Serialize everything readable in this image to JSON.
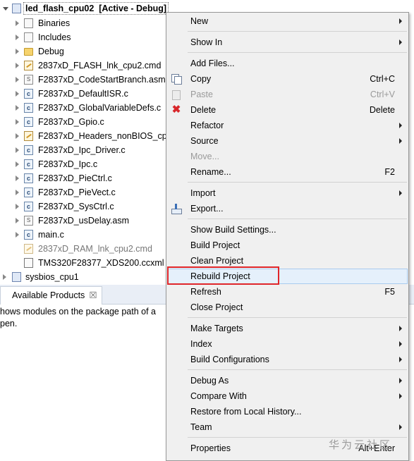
{
  "project": {
    "name": "led_flash_cpu02",
    "state": "[Active - Debug]"
  },
  "tree_items": [
    {
      "label": "Binaries",
      "icon": "binaries-icon",
      "expandable": true
    },
    {
      "label": "Includes",
      "icon": "includes-icon",
      "expandable": true
    },
    {
      "label": "Debug",
      "icon": "folder-icon",
      "expandable": true
    },
    {
      "label": "2837xD_FLASH_lnk_cpu2.cmd",
      "icon": "cmd-file-icon",
      "expandable": true
    },
    {
      "label": "F2837xD_CodeStartBranch.asm",
      "icon": "asm-file-icon",
      "expandable": true
    },
    {
      "label": "F2837xD_DefaultISR.c",
      "icon": "c-file-icon",
      "expandable": true
    },
    {
      "label": "F2837xD_GlobalVariableDefs.c",
      "icon": "c-file-icon",
      "expandable": true
    },
    {
      "label": "F2837xD_Gpio.c",
      "icon": "c-file-icon",
      "expandable": true
    },
    {
      "label": "F2837xD_Headers_nonBIOS_cp",
      "icon": "cmd-file-icon",
      "expandable": true
    },
    {
      "label": "F2837xD_Ipc_Driver.c",
      "icon": "c-file-icon",
      "expandable": true
    },
    {
      "label": "F2837xD_Ipc.c",
      "icon": "c-file-icon",
      "expandable": true
    },
    {
      "label": "F2837xD_PieCtrl.c",
      "icon": "c-file-icon",
      "expandable": true
    },
    {
      "label": "F2837xD_PieVect.c",
      "icon": "c-file-icon",
      "expandable": true
    },
    {
      "label": "F2837xD_SysCtrl.c",
      "icon": "c-file-icon",
      "expandable": true
    },
    {
      "label": "F2837xD_usDelay.asm",
      "icon": "asm-file-icon",
      "expandable": true
    },
    {
      "label": "main.c",
      "icon": "c-file-icon",
      "expandable": true
    },
    {
      "label": "2837xD_RAM_lnk_cpu2.cmd",
      "icon": "cmd-file-icon",
      "expandable": false,
      "excluded": true
    },
    {
      "label": "TMS320F28377_XDS200.ccxml",
      "icon": "ccxml-file-icon",
      "expandable": false
    }
  ],
  "second_project": {
    "label": "sysbios_cpu1",
    "icon": "rtsc-project-icon"
  },
  "panel": {
    "tab_label": "Available Products",
    "tab_close": "☒",
    "text_line1": "hows modules on the package path of a",
    "text_line2": "pen."
  },
  "menu": {
    "new": "New",
    "show_in": "Show In",
    "add_files": "Add Files...",
    "copy": "Copy",
    "copy_key": "Ctrl+C",
    "paste": "Paste",
    "paste_key": "Ctrl+V",
    "delete": "Delete",
    "delete_key": "Delete",
    "refactor": "Refactor",
    "source": "Source",
    "move": "Move...",
    "rename": "Rename...",
    "rename_key": "F2",
    "import": "Import",
    "export": "Export...",
    "show_build_settings": "Show Build Settings...",
    "build_project": "Build Project",
    "clean_project": "Clean Project",
    "rebuild_project": "Rebuild Project",
    "refresh": "Refresh",
    "refresh_key": "F5",
    "close_project": "Close Project",
    "make_targets": "Make Targets",
    "index": "Index",
    "build_configurations": "Build Configurations",
    "debug_as": "Debug As",
    "compare_with": "Compare With",
    "restore_local_history": "Restore from Local History...",
    "team": "Team",
    "properties": "Properties",
    "properties_key": "Alt+Enter"
  },
  "watermark": "华为云社区",
  "colors": {
    "highlight_box": "#e0262a",
    "menu_bg": "#f0f0f0",
    "hover_bg": "#e5f0fb"
  }
}
